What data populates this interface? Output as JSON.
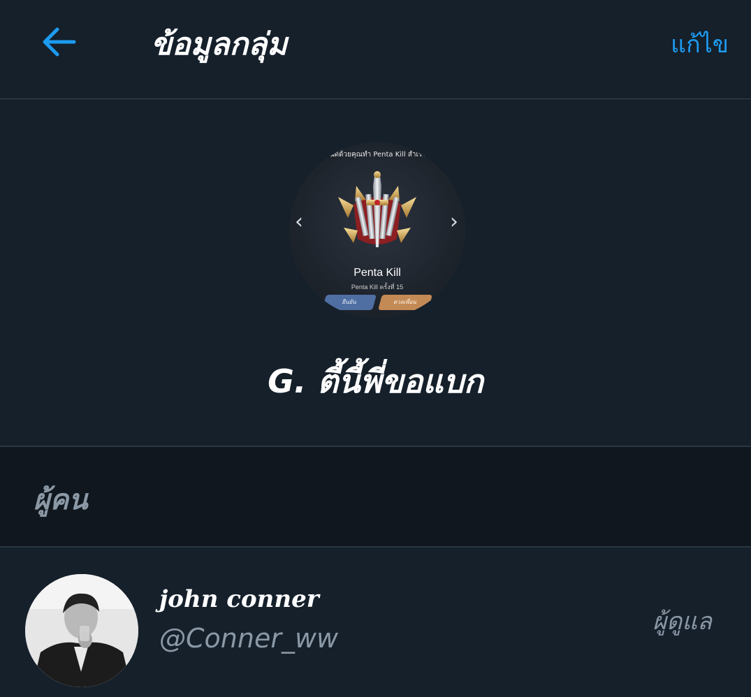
{
  "header": {
    "title": "ข้อมูลกลุ่ม",
    "edit_label": "แก้ไข",
    "back_icon": "arrow-left-icon",
    "accent_color": "#1d9bf0"
  },
  "group": {
    "name": "G. ตี้นี้พี่ขอแบก",
    "avatar": {
      "caption": "ยินดีด้วยคุณทำ Penta Kill สำเร็จ!",
      "title": "Penta Kill",
      "subtitle": "Penta Kill ครั้งที่ 15",
      "button_left": "ยืนยัน",
      "button_right": "ดวลเพื่อน"
    }
  },
  "people": {
    "section_label": "ผู้คน",
    "members": [
      {
        "display_name": "john conner",
        "handle": "@Conner_ww",
        "role": "ผู้ดูแล"
      }
    ]
  },
  "colors": {
    "background": "#15202b",
    "section_background": "#10171e",
    "secondary_text": "#8b98a5",
    "divider": "#38444d"
  }
}
